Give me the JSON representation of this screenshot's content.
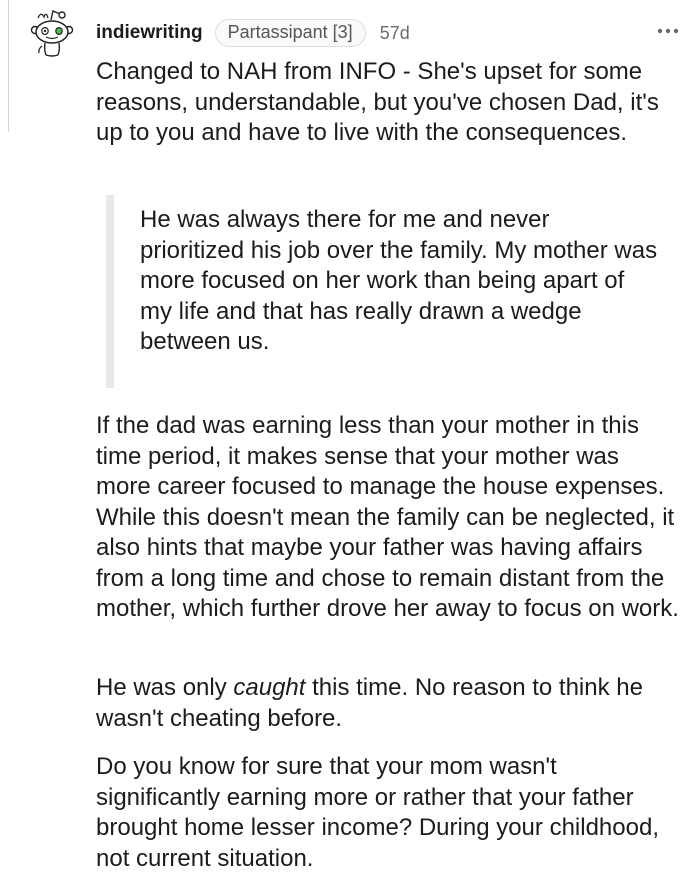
{
  "comment": {
    "username": "indiewriting",
    "flair": "Partassipant [3]",
    "age": "57d",
    "icons": {
      "avatar": "snoo-avatar-icon",
      "more": "more-options-icon"
    },
    "paragraphs": {
      "intro": "Changed to NAH from INFO - She's upset for some reasons, understandable, but you've chosen Dad, it's up to you and have to live with the consequences.",
      "quote": "He was always there for me and never prioritized his job over the family. My mother was more focused on her work than being apart of my life and that has really drawn a wedge between us.",
      "dad_earning": "If the dad was earning less than your mother in this time period, it makes sense that your mother was more career focused to manage the house expenses. While this doesn't mean the family can be neglected, it also hints that maybe your father was having affairs from a long time and chose to remain distant from the mother, which further drove her away to focus on work.",
      "caught_before": "He was only ",
      "caught_em": "caught",
      "caught_after": " this time. No reason to think he wasn't cheating before.",
      "know_for_sure": "Do you know for sure that your mom wasn't significantly earning more or rather that your father brought home lesser income? During your childhood, not current situation."
    }
  }
}
